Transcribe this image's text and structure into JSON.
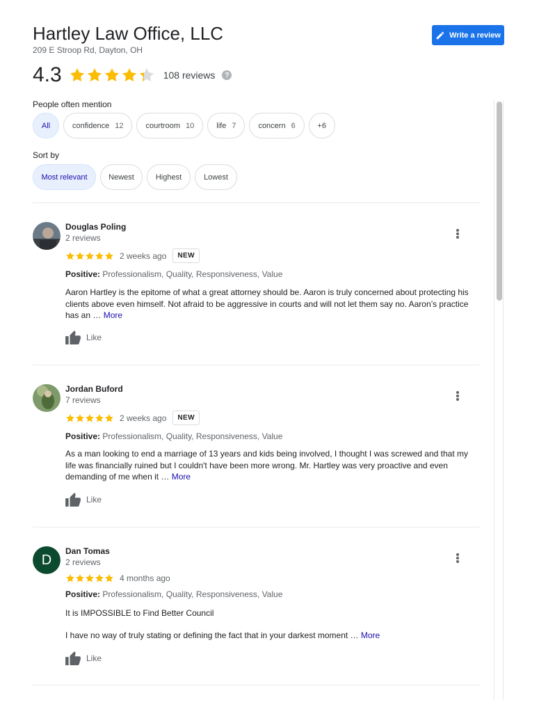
{
  "header": {
    "title": "Hartley Law Office, LLC",
    "address": "209 E Stroop Rd, Dayton, OH",
    "write_review_label": "Write a review",
    "rating": "4.3",
    "rating_value": 4.3,
    "review_count": "108 reviews",
    "help_glyph": "?"
  },
  "mentions": {
    "label": "People often mention",
    "chips": [
      {
        "label": "All",
        "count": ""
      },
      {
        "label": "confidence",
        "count": "12"
      },
      {
        "label": "courtroom",
        "count": "10"
      },
      {
        "label": "life",
        "count": "7"
      },
      {
        "label": "concern",
        "count": "6"
      },
      {
        "label": "+6",
        "count": ""
      }
    ]
  },
  "sort": {
    "label": "Sort by",
    "options": [
      "Most relevant",
      "Newest",
      "Highest",
      "Lowest"
    ],
    "selected": "Most relevant"
  },
  "reviews": [
    {
      "name": "Douglas Poling",
      "sub": "2 reviews",
      "stars": 5,
      "date": "2 weeks ago",
      "badge": "NEW",
      "positive_label": "Positive:",
      "positive_items": "Professionalism, Quality, Responsiveness, Value",
      "text": "Aaron Hartley is the epitome of what a great attorney should be. Aaron is truly concerned about protecting his clients above even himself.  Not afraid to be aggressive in courts and will not let them say no. Aaron’s practice has an … ",
      "more": "More",
      "like": "Like"
    },
    {
      "name": "Jordan Buford",
      "sub": "7 reviews",
      "stars": 5,
      "date": "2 weeks ago",
      "badge": "NEW",
      "positive_label": "Positive:",
      "positive_items": "Professionalism, Quality, Responsiveness, Value",
      "text": "As a man looking to end a marriage of 13 years and kids being involved, I thought I was screwed and that my life was financially ruined but I couldn't have been more wrong. Mr. Hartley was very proactive and even demanding of me when it … ",
      "more": "More",
      "like": "Like"
    },
    {
      "name": "Dan Tomas",
      "avatar_letter": "D",
      "sub": "2 reviews",
      "stars": 5,
      "date": "4 months ago",
      "badge": "",
      "positive_label": "Positive:",
      "positive_items": "Professionalism, Quality, Responsiveness, Value",
      "text_title": "It is IMPOSSIBLE to Find Better Council",
      "text": "I have no way of truly stating or defining the fact that in your darkest moment … ",
      "more": "More",
      "like": "Like"
    }
  ],
  "colors": {
    "accent": "#1a73e8",
    "star": "#fbbc04",
    "star_empty": "#dadce0",
    "link": "#1a0dab",
    "chip_active_bg": "#e8f0fe"
  },
  "icons": {
    "write": "pencil-icon",
    "help": "help-icon",
    "star": "star-icon",
    "menu": "more-vert-icon",
    "like": "thumbs-up-icon"
  }
}
